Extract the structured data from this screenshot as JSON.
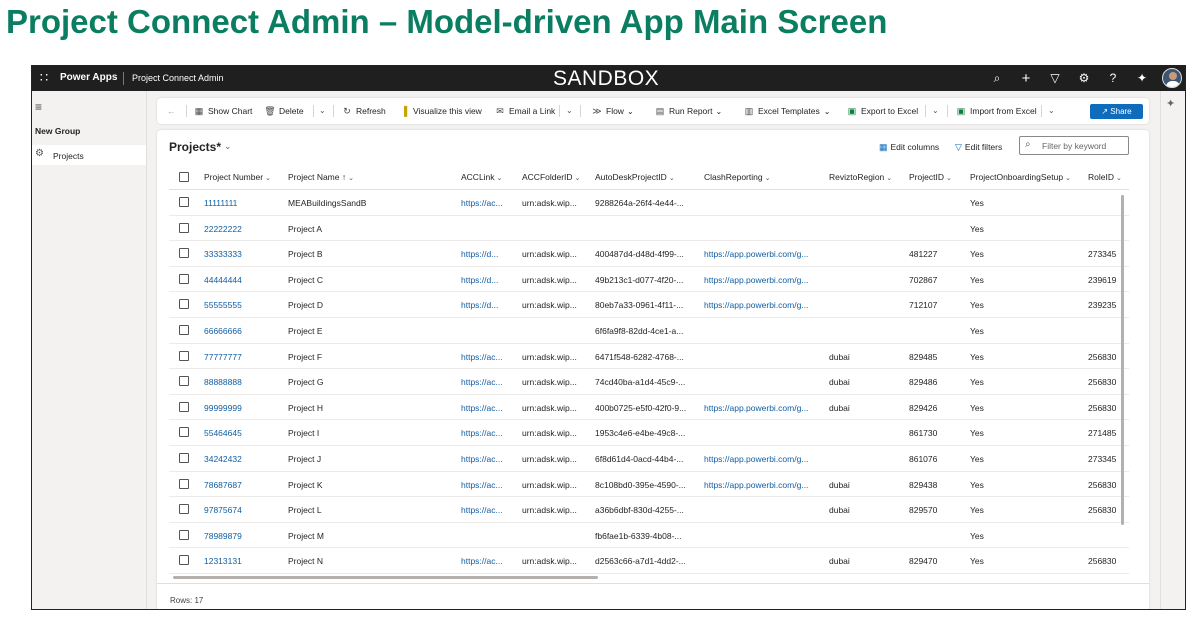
{
  "heading": "Project Connect Admin – Model-driven App Main Screen",
  "topbar": {
    "brand": "Power Apps",
    "app_name": "Project Connect Admin",
    "environment": "SANDBOX",
    "icons": [
      "search-icon",
      "plus-icon",
      "filter-icon",
      "gear-icon",
      "help-icon",
      "copilot-icon",
      "avatar"
    ]
  },
  "nav": {
    "group": "New Group",
    "items": [
      {
        "label": "Projects",
        "icon": "gear-icon"
      }
    ]
  },
  "commands": {
    "show_chart": "Show Chart",
    "delete": "Delete",
    "refresh": "Refresh",
    "visualize": "Visualize this view",
    "email_link": "Email a Link",
    "flow": "Flow",
    "run_report": "Run Report",
    "excel_templates": "Excel Templates",
    "export_excel": "Export to Excel",
    "import_excel": "Import from Excel",
    "share": "Share"
  },
  "view": {
    "title": "Projects*",
    "edit_columns": "Edit columns",
    "edit_filters": "Edit filters",
    "search_placeholder": "Filter by keyword",
    "rows_count": "Rows: 17"
  },
  "grid": {
    "columns": [
      "Project Number",
      "Project Name ↑",
      "ACCLink",
      "ACCFolderID",
      "AutoDeskProjectID",
      "ClashReporting",
      "ReviztoRegion",
      "ProjectID",
      "ProjectOnboardingSetup",
      "RoleID"
    ],
    "rows": [
      {
        "num": "11111111",
        "name": "MEABuildingsSandB",
        "acc": "https://ac...",
        "folder": "urn:adsk.wip...",
        "adsk": "9288264a-26f4-4e44-...",
        "clash": "",
        "region": "",
        "pid": "",
        "onboard": "Yes",
        "role": ""
      },
      {
        "num": "22222222",
        "name": "Project A",
        "acc": "",
        "folder": "",
        "adsk": "",
        "clash": "",
        "region": "",
        "pid": "",
        "onboard": "Yes",
        "role": ""
      },
      {
        "num": "33333333",
        "name": "Project B",
        "acc": "https://d...",
        "folder": "urn:adsk.wip...",
        "adsk": "400487d4-d48d-4f99-...",
        "clash": "https://app.powerbi.com/g...",
        "region": "",
        "pid": "481227",
        "onboard": "Yes",
        "role": "273345"
      },
      {
        "num": "44444444",
        "name": "Project C",
        "acc": "https://d...",
        "folder": "urn:adsk.wip...",
        "adsk": "49b213c1-d077-4f20-...",
        "clash": "https://app.powerbi.com/g...",
        "region": "",
        "pid": "702867",
        "onboard": "Yes",
        "role": "239619"
      },
      {
        "num": "55555555",
        "name": "Project D",
        "acc": "https://d...",
        "folder": "urn:adsk.wip...",
        "adsk": "80eb7a33-0961-4f11-...",
        "clash": "https://app.powerbi.com/g...",
        "region": "",
        "pid": "712107",
        "onboard": "Yes",
        "role": "239235"
      },
      {
        "num": "66666666",
        "name": "Project E",
        "acc": "",
        "folder": "",
        "adsk": "6f6fa9f8-82dd-4ce1-a...",
        "clash": "",
        "region": "",
        "pid": "",
        "onboard": "Yes",
        "role": ""
      },
      {
        "num": "77777777",
        "name": "Project F",
        "acc": "https://ac...",
        "folder": "urn:adsk.wip...",
        "adsk": "6471f548-6282-4768-...",
        "clash": "",
        "region": "dubai",
        "pid": "829485",
        "onboard": "Yes",
        "role": "256830"
      },
      {
        "num": "88888888",
        "name": "Project G",
        "acc": "https://ac...",
        "folder": "urn:adsk.wip...",
        "adsk": "74cd40ba-a1d4-45c9-...",
        "clash": "",
        "region": "dubai",
        "pid": "829486",
        "onboard": "Yes",
        "role": "256830"
      },
      {
        "num": "99999999",
        "name": "Project H",
        "acc": "https://ac...",
        "folder": "urn:adsk.wip...",
        "adsk": "400b0725-e5f0-42f0-9...",
        "clash": "https://app.powerbi.com/g...",
        "region": "dubai",
        "pid": "829426",
        "onboard": "Yes",
        "role": "256830"
      },
      {
        "num": "55464645",
        "name": "Project I",
        "acc": "https://ac...",
        "folder": "urn:adsk.wip...",
        "adsk": "1953c4e6-e4be-49c8-...",
        "clash": "",
        "region": "",
        "pid": "861730",
        "onboard": "Yes",
        "role": "271485"
      },
      {
        "num": "34242432",
        "name": "Project J",
        "acc": "https://ac...",
        "folder": "urn:adsk.wip...",
        "adsk": "6f8d61d4-0acd-44b4-...",
        "clash": "https://app.powerbi.com/g...",
        "region": "",
        "pid": "861076",
        "onboard": "Yes",
        "role": "273345"
      },
      {
        "num": "78687687",
        "name": "Project K",
        "acc": "https://ac...",
        "folder": "urn:adsk.wip...",
        "adsk": "8c108bd0-395e-4590-...",
        "clash": "https://app.powerbi.com/g...",
        "region": "dubai",
        "pid": "829438",
        "onboard": "Yes",
        "role": "256830"
      },
      {
        "num": "97875674",
        "name": "Project L",
        "acc": "https://ac...",
        "folder": "urn:adsk.wip...",
        "adsk": "a36b6dbf-830d-4255-...",
        "clash": "",
        "region": "dubai",
        "pid": "829570",
        "onboard": "Yes",
        "role": "256830"
      },
      {
        "num": "78989879",
        "name": "Project M",
        "acc": "",
        "folder": "",
        "adsk": "fb6fae1b-6339-4b08-...",
        "clash": "",
        "region": "",
        "pid": "",
        "onboard": "Yes",
        "role": ""
      },
      {
        "num": "12313131",
        "name": "Project N",
        "acc": "https://ac...",
        "folder": "urn:adsk.wip...",
        "adsk": "d2563c66-a7d1-4dd2-...",
        "clash": "",
        "region": "dubai",
        "pid": "829470",
        "onboard": "Yes",
        "role": "256830"
      }
    ]
  },
  "colors": {
    "heading": "#0b7e62",
    "topbar": "#1f1f1f",
    "link": "#115ea3",
    "accent": "#0f6cbd"
  }
}
